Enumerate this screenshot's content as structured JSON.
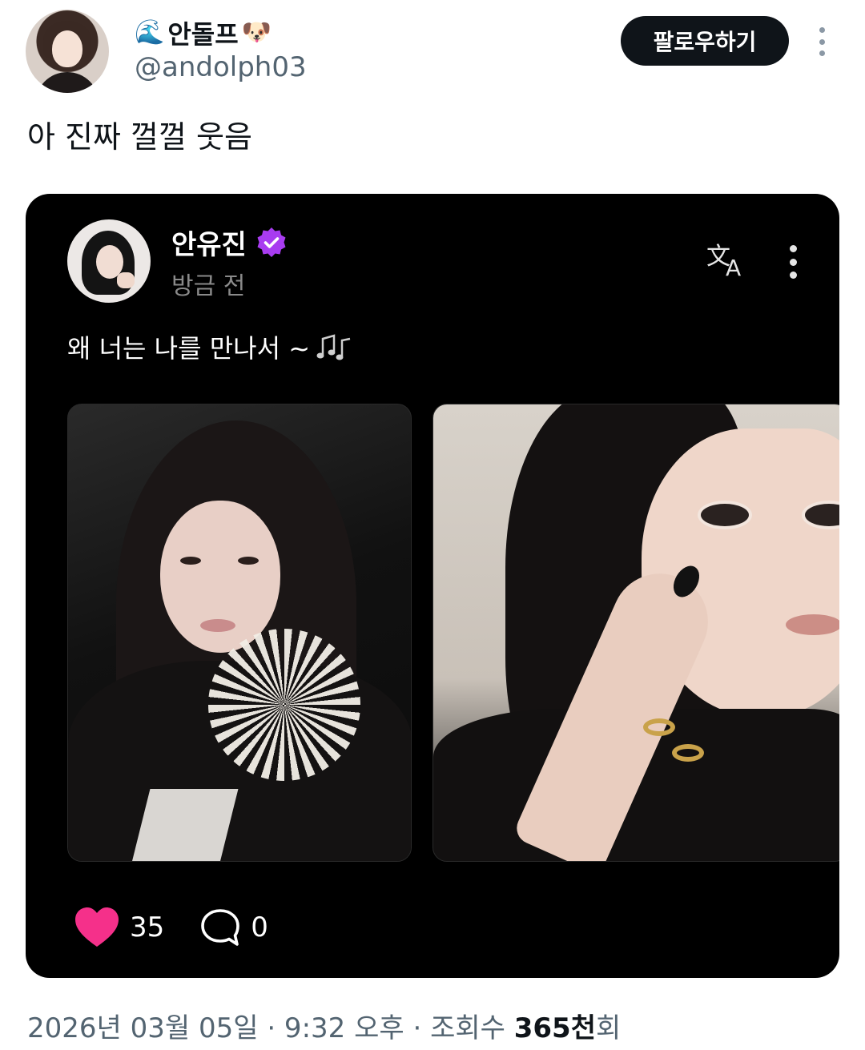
{
  "author": {
    "display_name": "안돌프",
    "leading_emoji": "🌊",
    "trailing_emoji": "🐶",
    "handle": "@andolph03"
  },
  "follow_button_label": "팔로우하기",
  "tweet_text": "아 진짜 껄껄 웃음",
  "quoted_post": {
    "author_name": "안유진",
    "timestamp": "방금 전",
    "text": "왜 너는 나를 만나서 ~",
    "likes_count": "35",
    "replies_count": "0",
    "verified_color": "#a83cf0",
    "heart_color": "#f5308a"
  },
  "meta": {
    "date_time": "2026년 03월 05일 · 9:32 오후 · 조회수 ",
    "views_count": "365천",
    "views_suffix": "회"
  }
}
